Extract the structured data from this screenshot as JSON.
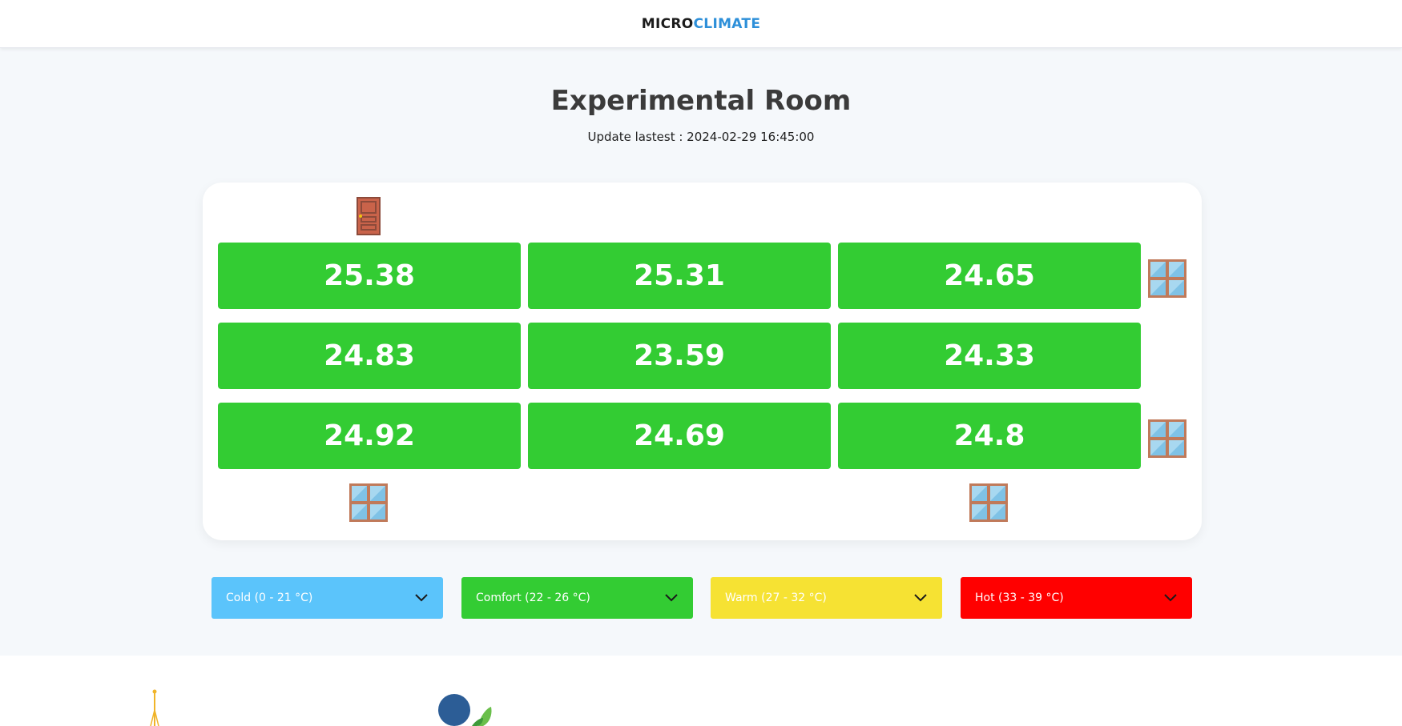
{
  "brand": {
    "part1": "MICRO",
    "part2": "CLIMATE"
  },
  "room": {
    "title": "Experimental Room",
    "updated": "Update lastest : 2024-02-29 16:45:00"
  },
  "grid": {
    "cells": [
      "25.38",
      "25.31",
      "24.65",
      "24.83",
      "23.59",
      "24.33",
      "24.92",
      "24.69",
      "24.8"
    ],
    "cell_color": "#33cc33"
  },
  "icons": {
    "door": "door-icon",
    "window": "window-icon"
  },
  "legend": [
    {
      "label": "Cold (0 - 21 °C)",
      "color": "#5bc4fb"
    },
    {
      "label": "Comfort (22 - 26 °C)",
      "color": "#33cc33"
    },
    {
      "label": "Warm (27 - 32 °C)",
      "color": "#f6e233"
    },
    {
      "label": "Hot (33 - 39 °C)",
      "color": "#ff0000"
    }
  ],
  "colors": {
    "brand_accent": "#2d8fd9",
    "background": "#f5f8fb"
  }
}
